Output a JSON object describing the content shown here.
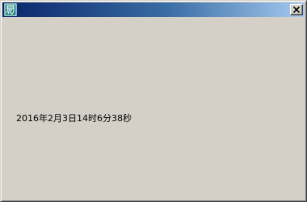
{
  "window": {
    "title": "",
    "icon": "app-icon",
    "close_icon": "close-icon"
  },
  "content": {
    "datetime_text": "2016年2月3日14时6分38秒"
  },
  "colors": {
    "titlebar_start": "#0a246a",
    "titlebar_end": "#a6caf0",
    "face": "#d4d0c8",
    "icon_bg": "#0b7a7a"
  }
}
